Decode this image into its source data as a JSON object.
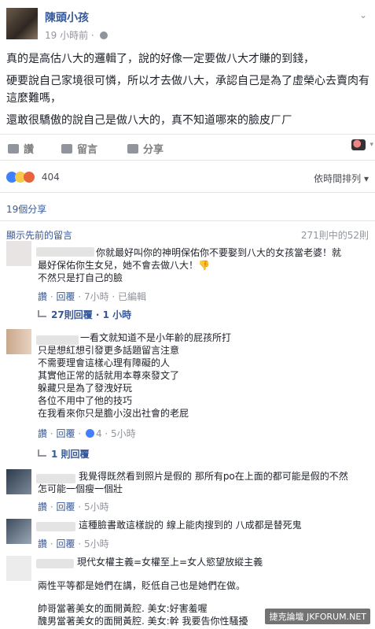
{
  "post": {
    "author": "陳頭小孩",
    "time": "19 小時前",
    "dot": "·",
    "lines": [
      "真的是高估八大的邏輯了，說的好像一定要做八大才賺的到錢，",
      "硬要說自己家境很可憐，所以才去做八大，承認自己是為了虛榮心去賣肉有這麼難嗎，",
      "還敢很驕傲的說自己是做八大的，真不知道哪來的臉皮ㄏㄏ"
    ]
  },
  "actions": {
    "like": "讚",
    "comment": "留言",
    "share": "分享"
  },
  "reactions": {
    "count": "404"
  },
  "sort_label": "依時間排列 ▾",
  "shares_label": "19個分享",
  "prev_comments": "顯示先前的留言",
  "comment_count": "271則中的52則",
  "comments": [
    {
      "lines": [
        "你就最好叫你的神明保佑你不要娶到八大的女孩當老婆！就",
        "最好保佑你生女兒，她不會去做八大！",
        "不然只是打自己的臉"
      ],
      "like": "讚",
      "reply": "回覆",
      "time": "7小時",
      "edited": "已編輯",
      "replies": "27則回覆 · 1 小時"
    },
    {
      "lines": [
        "一看文就知道不是小年齡的屁孩所打",
        "只是想紅想引發更多話題留言注意",
        "不需要理會這樣心理有障礙的人",
        "其實他正常的話就用本尊來發文了",
        "躲藏只是為了發洩好玩",
        "各位不用中了他的技巧",
        "在我看來你只是膽小沒出社會的老屁"
      ],
      "like": "讚",
      "reply": "回覆",
      "time": "5小時",
      "likes": "4",
      "replies": "1 則回覆"
    },
    {
      "lines": [
        "我覺得既然看到照片是假的 那所有po在上面的都可能是假的不然",
        "怎可能一個瘦一個壯"
      ],
      "like": "讚",
      "reply": "回覆",
      "time": "5小時"
    },
    {
      "lines": [
        "這種臉書敢這樣說的 線上能肉搜到的 八成都是替死鬼"
      ],
      "like": "讚",
      "reply": "回覆",
      "time": "5小時"
    },
    {
      "lines": [
        "現代女權主義=女權至上=女人慾望放縱主義",
        "兩性平等都是她們在講，貶低自己也是她們在做。",
        "帥哥當著美女的面開黃腔. 美女:好害羞喔",
        "醜男當著美女的面開黃腔. 美女:幹 我要告你性騷擾"
      ]
    }
  ],
  "watermark": "捷克論壇 JKFORUM.NET"
}
